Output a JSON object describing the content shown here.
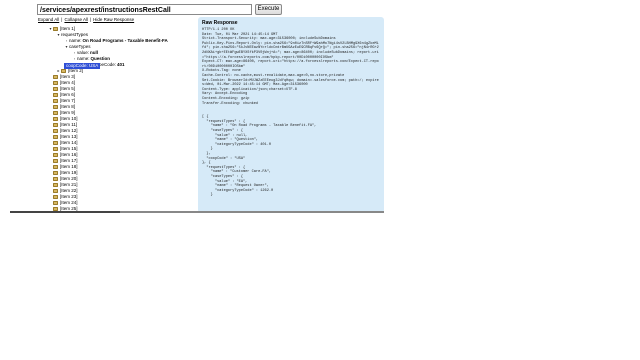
{
  "toolbar": {
    "url": "/services/apexrest/instructionsRestCall",
    "execute_label": "Execute"
  },
  "links": {
    "expand_all": "Expand All",
    "collapse_all": "Collapse All",
    "hide_raw": "Hide Raw Response"
  },
  "tree": {
    "item1": "[Item 1]",
    "request_types": "requestTypes",
    "name_key": "name:",
    "name_val": "On Road Programs - Taxable Benefit-FA",
    "case_types": "caseTypes",
    "value_key": "value:",
    "value_val": "null",
    "name2_key": "name:",
    "name2_val": "Question",
    "cat_key": "categoryTypeCode:",
    "cat_val": "401",
    "item2": "[Item 2]",
    "coop_selected": "coopCode: USA",
    "items": [
      "[Item 3]",
      "[Item 4]",
      "[Item 5]",
      "[Item 6]",
      "[Item 7]",
      "[Item 8]",
      "[Item 9]",
      "[Item 10]",
      "[Item 11]",
      "[Item 12]",
      "[Item 13]",
      "[Item 14]",
      "[Item 15]",
      "[Item 16]",
      "[Item 17]",
      "[Item 18]",
      "[Item 19]",
      "[Item 20]",
      "[Item 21]",
      "[Item 22]",
      "[Item 23]",
      "[Item 24]",
      "[Item 25]"
    ]
  },
  "response": {
    "title": "Raw Response",
    "body": "HTTP/1.1 200 OK\nDate: Tue, 01 Mar 2021 14:45:14 GMT\nStrict-Transport-Security: max-age=31536000; includeSubDomains\nPublic-Key-Pins-Report-Only: pin-sha256=\"9n0izTnSRF+W9ahMo7Ngi4sV2LBHMg9X6n4gZkeMLfd\"; pin-sha256=\"5kJvNEEazNYcrldcCmtrBmUGAzEuE9CRBqFv6QrQ=\"; pin-sha256=\"njN4rRG+22dNXAi+gb+EEtWFgwEBYXSfkP3V0jWnj+A=\"; max-age=86400; includeSubDomains; report-uri=\"https://a.forcesslreports.com/hpkp-report/00Di0000000IOSbm\"\nExpect-CT: max-age=86400, report-uri=\"https://a.forcesslreports.com/Expect-CT-report/00Di0000000IOSbm\"\nX-Robots-Tag: none\nCache-Control: no-cache,must-revalidate,max-age=0,no-store,private\nSet-Cookie: BrowserId=MUJWZzEEEeug3JdYqHqw; domain=.salesforce.com; path=/; expires=Wed, 01-Mar-2022 14:45:14 GMT; Max-Age=31536000\nContent-Type: application/json;charset=UTF-8\nVary: Accept-Encoding\nContent-Encoding: gzip\nTransfer-Encoding: chunked\n\n\n[ {\n  \"requestTypes\" : {\n    \"name\" : \"On Road Programs - Taxable Benefit-FA\",\n    \"caseTypes\" : {\n      \"value\" : null,\n      \"name\" : \"Question\",\n      \"categoryTypeCode\" : 401.0\n    }\n  },\n  \"coopCode\" : \"USA\"\n}, {\n  \"requestTypes\" : {\n    \"name\" : \"Customer Care-FA\",\n    \"caseTypes\" : {\n      \"value\" : \"EA\",\n      \"name\" : \"Request Owner\",\n      \"categoryTypeCode\" : 1262.0\n    }"
  }
}
